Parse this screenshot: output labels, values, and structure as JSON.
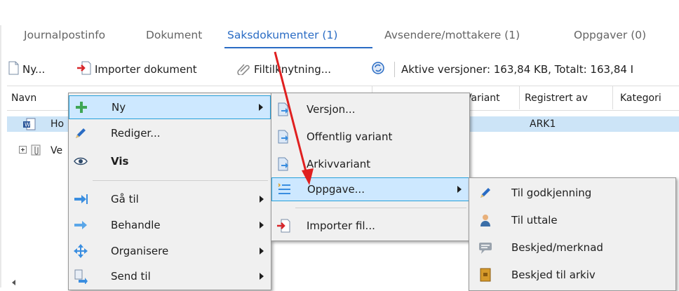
{
  "tabs": [
    {
      "label": "Journalpostinfo"
    },
    {
      "label": "Dokument"
    },
    {
      "label": "Saksdokumenter (1)"
    },
    {
      "label": "Avsendere/mottakere (1)"
    },
    {
      "label": "Oppgaver (0)"
    }
  ],
  "toolbar": {
    "new_label": "Ny...",
    "import_label": "Importer dokument",
    "attach_label": "Filtilknytning...",
    "versions_label": "Aktive versjoner: 163,84 KB,  Totalt: 163,84 I"
  },
  "grid": {
    "columns": [
      "Navn",
      "Variant",
      "Registrert av",
      "Kategori"
    ],
    "rows": [
      {
        "name": "Ho",
        "registered_by": "ARK1"
      },
      {
        "name": "Ve"
      }
    ]
  },
  "context_menu": {
    "items": [
      {
        "label": "Ny",
        "icon": "plus-icon",
        "submenu": true
      },
      {
        "label": "Rediger...",
        "icon": "pencil-icon"
      },
      {
        "label": "Vis",
        "icon": "eye-icon"
      },
      {
        "label": "Gå til",
        "icon": "arrow-right-icon",
        "submenu": true
      },
      {
        "label": "Behandle",
        "icon": "process-arrow-icon",
        "submenu": true
      },
      {
        "label": "Organisere",
        "icon": "move-icon",
        "submenu": true
      },
      {
        "label": "Send til",
        "icon": "send-icon",
        "submenu": true
      }
    ]
  },
  "new_submenu": {
    "items": [
      {
        "label": "Versjon...",
        "icon": "document-arrow-icon"
      },
      {
        "label": "Offentlig variant",
        "icon": "document-arrow-icon"
      },
      {
        "label": "Arkivvariant",
        "icon": "document-arrow-icon"
      },
      {
        "label": "Oppgave...",
        "icon": "task-list-icon",
        "submenu": true
      },
      {
        "label": "Importer fil...",
        "icon": "import-file-icon"
      }
    ]
  },
  "task_submenu": {
    "items": [
      {
        "label": "Til godkjenning",
        "icon": "pencil-icon"
      },
      {
        "label": "Til uttale",
        "icon": "person-icon"
      },
      {
        "label": "Beskjed/merknad",
        "icon": "comment-icon"
      },
      {
        "label": "Beskjed til arkiv",
        "icon": "archive-icon"
      }
    ]
  },
  "colors": {
    "active_tab": "#2a6cc4",
    "highlight": "#cde8ff",
    "annotation_arrow": "#e02020"
  }
}
